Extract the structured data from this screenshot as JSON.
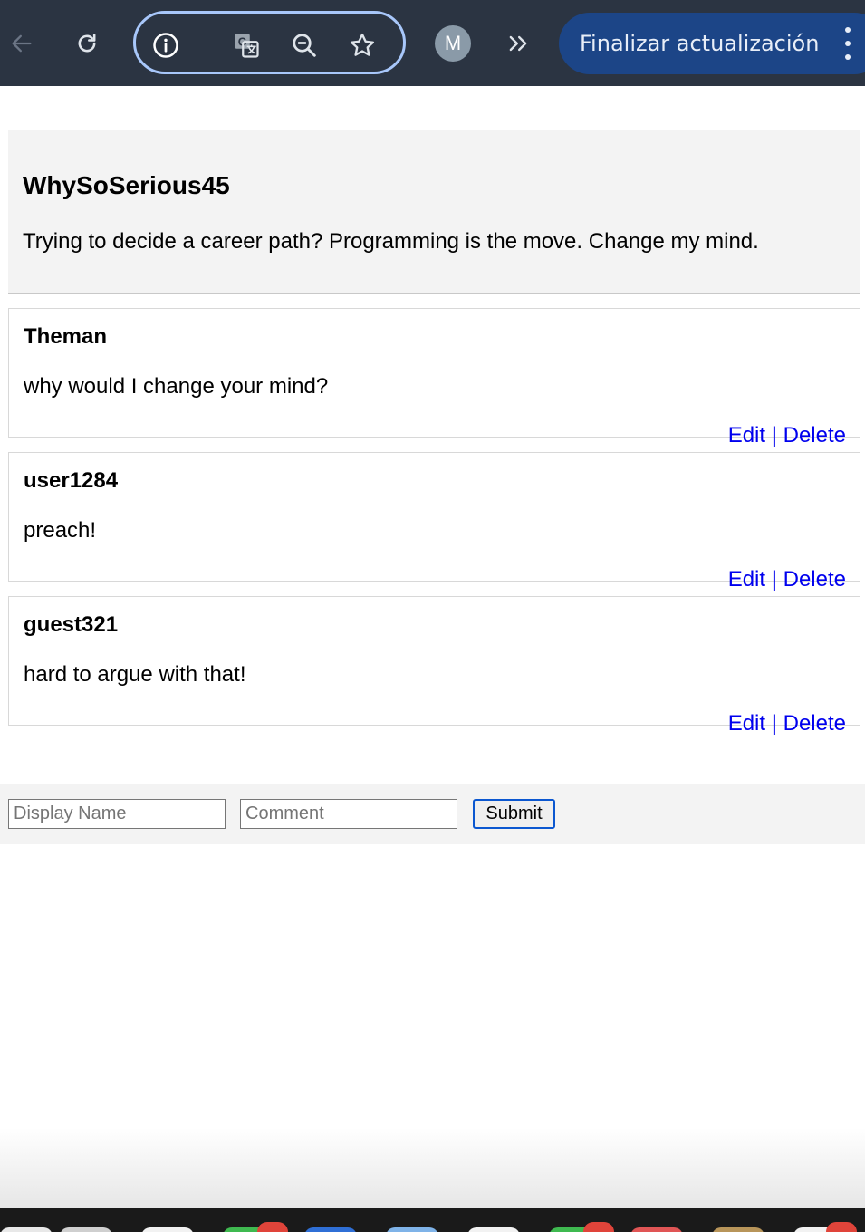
{
  "browser": {
    "avatar_initial": "M",
    "update_button": "Finalizar actualización",
    "icons": [
      "back-arrow-icon",
      "reload-icon",
      "site-info-icon",
      "translate-icon",
      "zoom-out-icon",
      "bookmark-star-icon",
      "chevrons-right-icon",
      "more-vert-icon"
    ],
    "colors": {
      "toolbar": "#2b3442",
      "omnibox_border": "#a8c7fa",
      "update_button": "#1c4587"
    }
  },
  "post": {
    "author": "WhySoSerious45",
    "text": "Trying to decide a career path? Programming is the move. Change my mind."
  },
  "comments": [
    {
      "author": "Theman",
      "text": "why would I change your mind?",
      "edit": "Edit",
      "separator": "|",
      "delete": "Delete"
    },
    {
      "author": "user1284",
      "text": "preach!",
      "edit": "Edit",
      "separator": "|",
      "delete": "Delete"
    },
    {
      "author": "guest321",
      "text": "hard to argue with that!",
      "edit": "Edit",
      "separator": "|",
      "delete": "Delete"
    }
  ],
  "form": {
    "name_placeholder": "Display Name",
    "comment_placeholder": "Comment",
    "submit_label": "Submit"
  },
  "colors": {
    "link": "#0000ee",
    "panel": "#f3f3f3"
  }
}
